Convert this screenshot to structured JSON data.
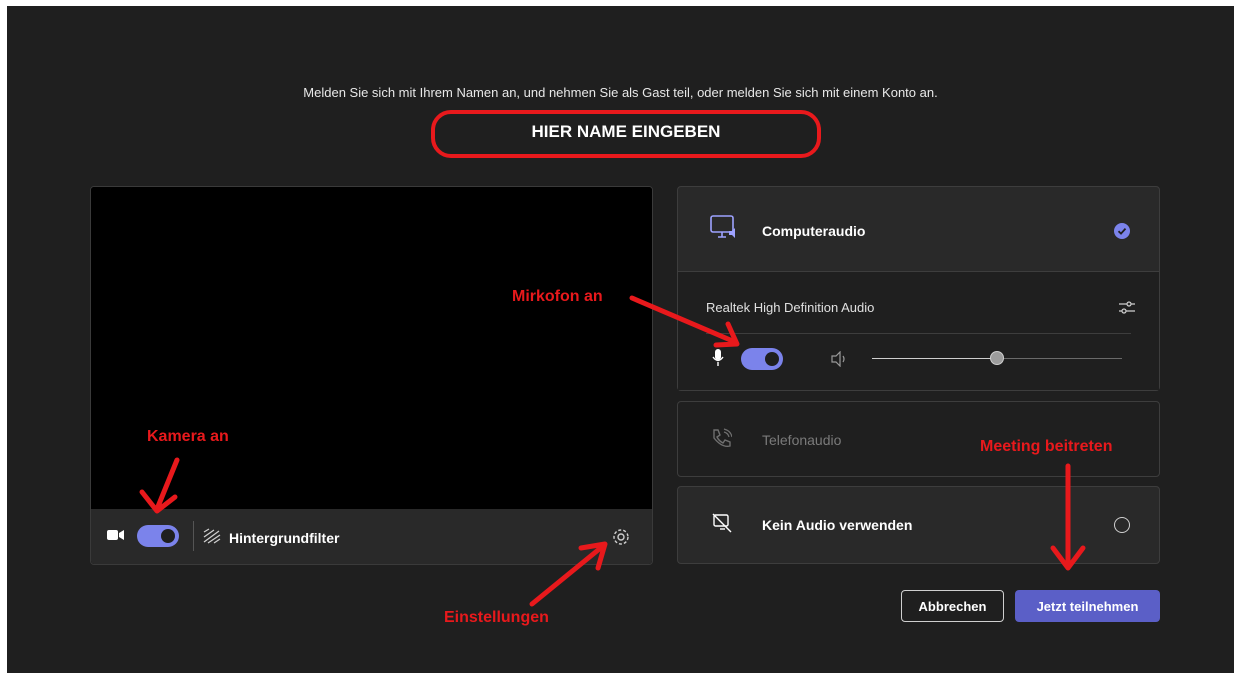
{
  "join": {
    "instruction": "Melden Sie sich mit Ihrem Namen an, und nehmen Sie als Gast teil, oder melden Sie sich mit einem Konto an.",
    "name_value": "HIER NAME EINGEBEN"
  },
  "video": {
    "camera_on": true,
    "background_filter_label": "Hintergrundfilter"
  },
  "audio": {
    "computer_audio_label": "Computeraudio",
    "computer_audio_selected": true,
    "device_name": "Realtek High Definition Audio",
    "mic_on": true,
    "speaker_volume": 0.5,
    "phone_audio_label": "Telefonaudio",
    "no_audio_label": "Kein Audio verwenden"
  },
  "actions": {
    "cancel_label": "Abbrechen",
    "join_label": "Jetzt teilnehmen"
  },
  "annotations": {
    "camera": "Kamera an",
    "mic": "Mirkofon an",
    "settings": "Einstellungen",
    "join": "Meeting beitreten"
  },
  "colors": {
    "background": "#1f1f1f",
    "panel": "#292929",
    "accent": "#5b5fc7",
    "toggle": "#7b83eb",
    "annotation": "#e8191c"
  },
  "icons": {
    "camera": "video-camera-icon",
    "background_filter": "background-filter-icon",
    "settings": "gear-icon",
    "computer_audio": "computer-speaker-icon",
    "device_settings": "sliders-icon",
    "mic": "microphone-icon",
    "speaker": "speaker-icon",
    "phone": "phone-icon",
    "no_audio": "no-audio-icon"
  }
}
